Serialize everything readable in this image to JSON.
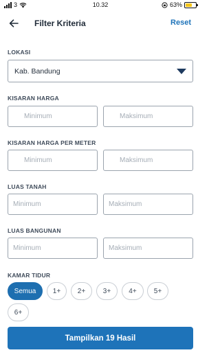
{
  "status_bar": {
    "carrier": "3",
    "time": "10.32",
    "battery_percent": "63%",
    "battery_level": 0.63
  },
  "header": {
    "back_icon": "arrow-left-icon",
    "title": "Filter Kriteria",
    "reset_label": "Reset"
  },
  "lokasi": {
    "label": "LOKASI",
    "selected": "Kab. Bandung"
  },
  "kisaran_harga": {
    "label": "KISARAN HARGA",
    "min_placeholder": "Minimum",
    "max_placeholder": "Maksimum"
  },
  "kisaran_harga_per_meter": {
    "label": "KISARAN HARGA PER METER",
    "min_placeholder": "Minimum",
    "max_placeholder": "Maksimum"
  },
  "luas_tanah": {
    "label": "LUAS TANAH",
    "min_placeholder": "Minimum",
    "max_placeholder": "Maksimum"
  },
  "luas_bangunan": {
    "label": "LUAS BANGUNAN",
    "min_placeholder": "Minimum",
    "max_placeholder": "Maksimum"
  },
  "kamar_tidur": {
    "label": "KAMAR TIDUR",
    "options": [
      "Semua",
      "1+",
      "2+",
      "3+",
      "4+",
      "5+",
      "6+"
    ],
    "selected": "Semua"
  },
  "submit_label": "Tampilkan 19 Hasil",
  "colors": {
    "accent": "#1e73b9",
    "text": "#1f2a37",
    "border": "#9aa3ad"
  }
}
